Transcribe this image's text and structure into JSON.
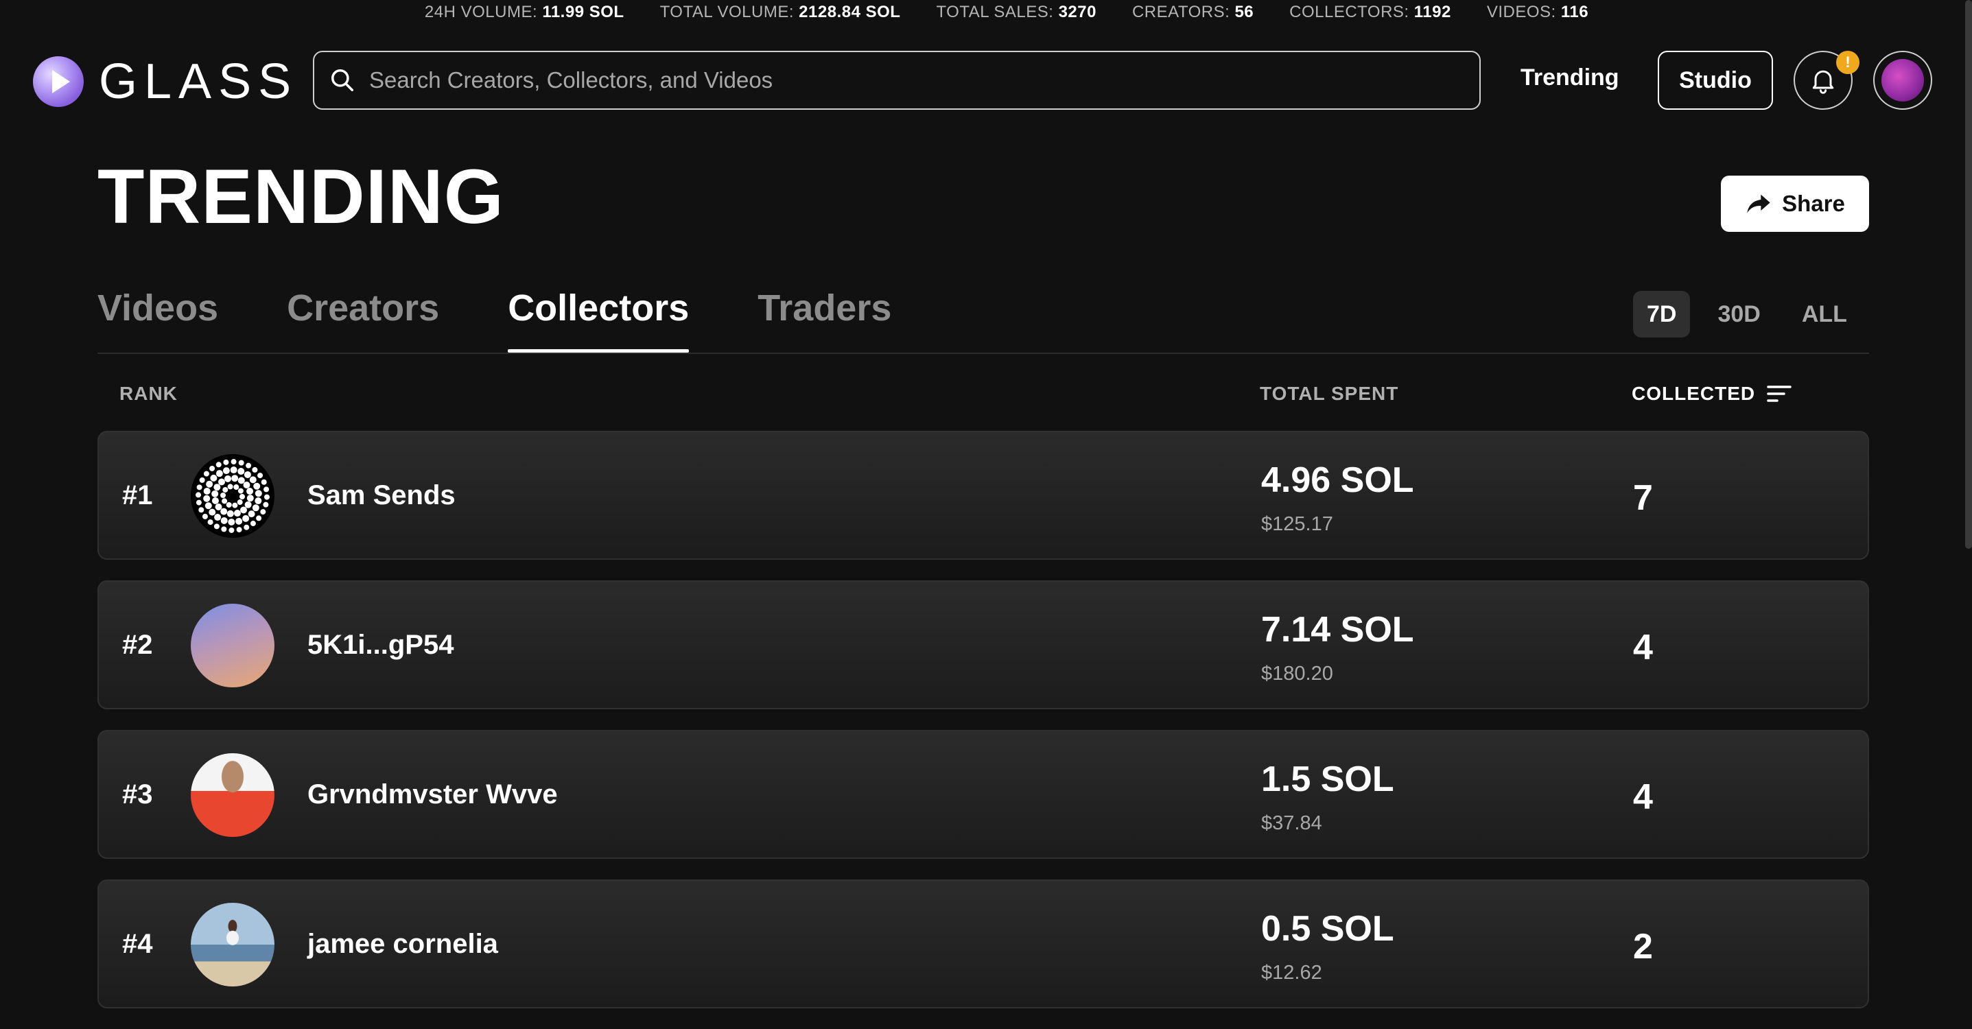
{
  "stats": [
    {
      "label": "24H VOLUME:",
      "value": "11.99 SOL"
    },
    {
      "label": "TOTAL VOLUME:",
      "value": "2128.84 SOL"
    },
    {
      "label": "TOTAL SALES:",
      "value": "3270"
    },
    {
      "label": "CREATORS:",
      "value": "56"
    },
    {
      "label": "COLLECTORS:",
      "value": "1192"
    },
    {
      "label": "VIDEOS:",
      "value": "116"
    }
  ],
  "header": {
    "logo_text": "GLASS",
    "search_placeholder": "Search Creators, Collectors, and Videos",
    "nav_trending": "Trending",
    "studio_label": "Studio",
    "notification_badge": "!"
  },
  "page": {
    "title": "TRENDING",
    "share_label": "Share"
  },
  "tabs": [
    {
      "label": "Videos",
      "active": false
    },
    {
      "label": "Creators",
      "active": false
    },
    {
      "label": "Collectors",
      "active": true
    },
    {
      "label": "Traders",
      "active": false
    }
  ],
  "periods": [
    {
      "label": "7D",
      "active": true
    },
    {
      "label": "30D",
      "active": false
    },
    {
      "label": "ALL",
      "active": false
    }
  ],
  "table": {
    "headers": {
      "rank": "RANK",
      "total_spent": "TOTAL SPENT",
      "collected": "COLLECTED"
    },
    "rows": [
      {
        "rank": "#1",
        "name": "Sam Sends",
        "sol": "4.96 SOL",
        "usd": "$125.17",
        "collected": "7"
      },
      {
        "rank": "#2",
        "name": "5K1i...gP54",
        "sol": "7.14 SOL",
        "usd": "$180.20",
        "collected": "4"
      },
      {
        "rank": "#3",
        "name": "Grvndmvster Wvve",
        "sol": "1.5 SOL",
        "usd": "$37.84",
        "collected": "4"
      },
      {
        "rank": "#4",
        "name": "jamee cornelia",
        "sol": "0.5 SOL",
        "usd": "$12.62",
        "collected": "2"
      }
    ]
  },
  "colors": {
    "background": "#111111",
    "accent": "#8a63e0",
    "badge": "#f0a81c"
  }
}
